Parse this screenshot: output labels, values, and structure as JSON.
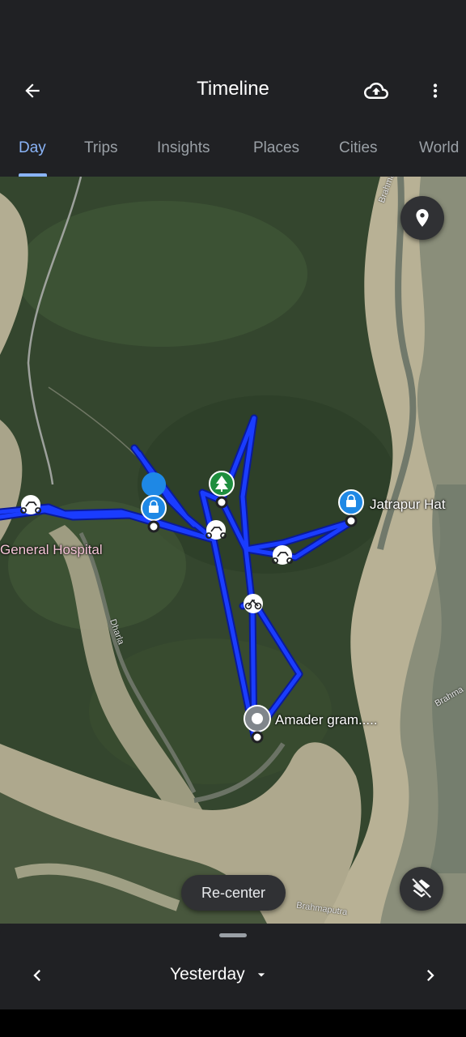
{
  "app_bar": {
    "title": "Timeline",
    "back_icon": "arrow-left-icon",
    "upload_icon": "cloud-upload-icon",
    "more_icon": "more-vert-icon"
  },
  "tabs": [
    {
      "label": "Day",
      "active": true
    },
    {
      "label": "Trips",
      "active": false
    },
    {
      "label": "Insights",
      "active": false
    },
    {
      "label": "Places",
      "active": false
    },
    {
      "label": "Cities",
      "active": false
    },
    {
      "label": "World",
      "active": false
    }
  ],
  "map": {
    "labels": {
      "place_1": "Jatrapur Hat",
      "place_2": "Amader gram.....",
      "place_3": "General Hospital"
    },
    "river_labels": {
      "top": "Brahmaputra",
      "right": "Brahma",
      "bottom": "Brahmaputra",
      "left": "Dharla"
    },
    "route_color": "#1a3cff",
    "marker_icons": [
      "shopping-bag-icon",
      "park-icon",
      "location-pin-icon",
      "motorcycle-icon",
      "bicycle-icon"
    ],
    "recenter_label": "Re-center",
    "place_fab_icon": "place-pin-icon",
    "layers_fab_icon": "layers-off-icon"
  },
  "bottom_sheet": {
    "date_label": "Yesterday",
    "prev_icon": "chevron-left-icon",
    "next_icon": "chevron-right-icon",
    "dropdown_icon": "caret-down-icon"
  },
  "colors": {
    "background": "#202124",
    "accent": "#8ab4f8",
    "shopping_marker": "#1e88e5",
    "park_marker": "#1e8e3e",
    "home_marker": "#5f6368"
  }
}
